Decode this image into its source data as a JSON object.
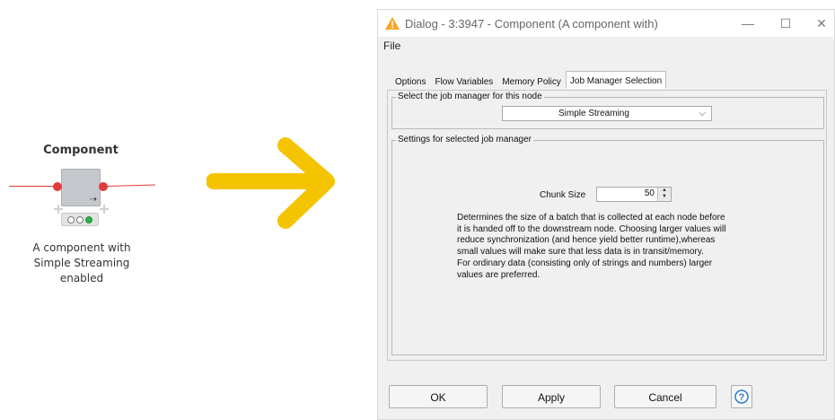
{
  "node": {
    "title": "Component",
    "description_lines": [
      "A component with",
      "Simple Streaming",
      "enabled"
    ],
    "stream_glyph": "⇢"
  },
  "colors": {
    "port_red": "#e23b3b",
    "status_green": "#2fb14a",
    "arrow_yellow": "#f5c400",
    "warning_orange": "#f5a623",
    "help_blue": "#2b7cd3"
  },
  "dialog": {
    "title": "Dialog - 3:3947 - Component (A component with)",
    "menu": [
      "File"
    ],
    "tabs": [
      "Options",
      "Flow Variables",
      "Memory Policy",
      "Job Manager Selection"
    ],
    "active_tab": "Job Manager Selection",
    "group_job_manager": {
      "legend": "Select the job manager for this node",
      "selected": "Simple Streaming"
    },
    "group_settings": {
      "legend": "Settings for selected job manager",
      "chunk_label": "Chunk Size",
      "chunk_value": "50",
      "description_lines": [
        "Determines the size of a batch that is collected at each node before",
        "it is handed off to the downstream node. Choosing larger values will",
        "reduce synchronization (and hence yield better runtime),whereas",
        "small values will make sure that less data is in transit/memory.",
        "For ordinary data (consisting only of strings and numbers) larger",
        "values are preferred."
      ]
    },
    "buttons": {
      "ok": "OK",
      "apply": "Apply",
      "cancel": "Cancel"
    },
    "icons": [
      "warning-icon",
      "minimize-icon",
      "maximize-icon",
      "close-icon",
      "help-icon",
      "chevron-down-icon"
    ]
  }
}
